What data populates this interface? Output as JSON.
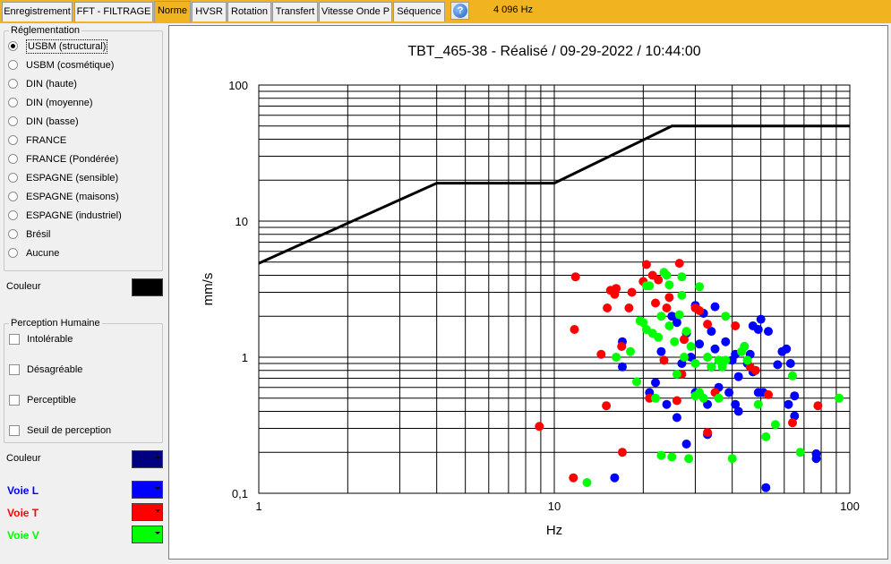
{
  "tabs": [
    {
      "label": "Enregistrement",
      "active": false
    },
    {
      "label": "FFT - FILTRAGE",
      "active": false
    },
    {
      "label": "Norme",
      "active": true
    },
    {
      "label": "HVSR",
      "active": false
    },
    {
      "label": "Rotation",
      "active": false
    },
    {
      "label": "Transfert",
      "active": false
    },
    {
      "label": "Vitesse Onde P",
      "active": false
    },
    {
      "label": "Séquence",
      "active": false
    }
  ],
  "help_icon": "help-icon",
  "sample_rate": "4 096 Hz",
  "reglementation": {
    "title": "Réglementation",
    "options": [
      {
        "label": "USBM (structural)",
        "checked": true
      },
      {
        "label": "USBM (cosmétique)",
        "checked": false
      },
      {
        "label": "DIN (haute)",
        "checked": false
      },
      {
        "label": "DIN (moyenne)",
        "checked": false
      },
      {
        "label": "DIN (basse)",
        "checked": false
      },
      {
        "label": "FRANCE",
        "checked": false
      },
      {
        "label": "FRANCE (Pondérée)",
        "checked": false
      },
      {
        "label": "ESPAGNE (sensible)",
        "checked": false
      },
      {
        "label": "ESPAGNE (maisons)",
        "checked": false
      },
      {
        "label": "ESPAGNE (industriel)",
        "checked": false
      },
      {
        "label": "Brésil",
        "checked": false
      },
      {
        "label": "Aucune",
        "checked": false
      }
    ]
  },
  "couleur_norme": {
    "label": "Couleur",
    "color": "#000000"
  },
  "perception": {
    "title": "Perception Humaine",
    "options": [
      {
        "label": "Intolérable",
        "checked": false
      },
      {
        "label": "Désagréable",
        "checked": false
      },
      {
        "label": "Perceptible",
        "checked": false
      },
      {
        "label": "Seuil de perception",
        "checked": false
      }
    ]
  },
  "couleur_perception": {
    "label": "Couleur",
    "color": "#000080"
  },
  "voies": [
    {
      "label": "Voie L",
      "color": "#0000ff"
    },
    {
      "label": "Voie T",
      "color": "#ff0000"
    },
    {
      "label": "Voie V",
      "color": "#00ff00"
    }
  ],
  "chart_data": {
    "type": "scatter",
    "title": "TBT_465-38 - Réalisé / 09-29-2022 / 10:44:00",
    "xlabel": "Hz",
    "ylabel": "mm/s",
    "x_scale": "log",
    "y_scale": "log",
    "xlim": [
      1,
      100
    ],
    "ylim": [
      0.1,
      100
    ],
    "x_tick_labels": [
      "1",
      "10",
      "100"
    ],
    "y_tick_labels": [
      "0,1",
      "1",
      "10",
      "100"
    ],
    "grid": true,
    "norm_color": "#000000",
    "norm_curve": [
      [
        1,
        4.9
      ],
      [
        4,
        19
      ],
      [
        10,
        19
      ],
      [
        25,
        50
      ],
      [
        100,
        50
      ]
    ],
    "series": [
      {
        "color": "#0000ff",
        "points": [
          [
            16,
            0.13
          ],
          [
            17,
            0.85
          ],
          [
            17,
            1.3
          ],
          [
            21,
            0.55
          ],
          [
            22,
            0.65
          ],
          [
            23,
            1.1
          ],
          [
            24,
            0.45
          ],
          [
            25,
            2.0
          ],
          [
            26,
            0.36
          ],
          [
            26,
            1.8
          ],
          [
            27,
            0.9
          ],
          [
            28,
            0.23
          ],
          [
            28,
            1.5
          ],
          [
            29,
            1.0
          ],
          [
            30,
            2.4
          ],
          [
            30,
            0.55
          ],
          [
            31,
            1.25
          ],
          [
            32,
            2.1
          ],
          [
            33,
            0.45
          ],
          [
            33,
            0.27
          ],
          [
            34,
            0.85
          ],
          [
            34,
            1.55
          ],
          [
            35,
            1.15
          ],
          [
            35,
            2.35
          ],
          [
            36,
            0.6
          ],
          [
            37,
            0.9
          ],
          [
            38,
            1.3
          ],
          [
            39,
            0.55
          ],
          [
            40,
            0.95
          ],
          [
            41,
            1.05
          ],
          [
            41,
            0.45
          ],
          [
            42,
            0.72
          ],
          [
            42,
            0.4
          ],
          [
            44,
            1.2
          ],
          [
            45,
            0.9
          ],
          [
            46,
            1.05
          ],
          [
            47,
            0.78
          ],
          [
            47,
            1.7
          ],
          [
            49,
            0.55
          ],
          [
            49,
            1.6
          ],
          [
            50,
            1.9
          ],
          [
            51,
            0.55
          ],
          [
            52,
            0.11
          ],
          [
            53,
            1.55
          ],
          [
            57,
            0.88
          ],
          [
            59,
            1.1
          ],
          [
            61,
            1.15
          ],
          [
            62,
            0.45
          ],
          [
            63,
            0.9
          ],
          [
            65,
            0.52
          ],
          [
            65,
            0.37
          ],
          [
            77,
            0.195
          ],
          [
            77,
            0.18
          ]
        ]
      },
      {
        "color": "#ff0000",
        "points": [
          [
            8.9,
            0.31
          ],
          [
            11.6,
            0.13
          ],
          [
            11.7,
            1.6
          ],
          [
            11.8,
            3.9
          ],
          [
            14.4,
            1.05
          ],
          [
            15,
            0.44
          ],
          [
            15.1,
            2.3
          ],
          [
            15.5,
            3.1
          ],
          [
            16,
            2.9
          ],
          [
            16.2,
            3.2
          ],
          [
            16.9,
            1.2
          ],
          [
            17,
            0.2
          ],
          [
            17.9,
            2.3
          ],
          [
            18.3,
            3.0
          ],
          [
            20,
            3.6
          ],
          [
            20.5,
            4.8
          ],
          [
            21,
            0.5
          ],
          [
            21.5,
            4.0
          ],
          [
            22,
            2.5
          ],
          [
            22.5,
            3.7
          ],
          [
            23.5,
            0.95
          ],
          [
            24,
            2.3
          ],
          [
            24.5,
            2.75
          ],
          [
            26,
            0.48
          ],
          [
            26.5,
            4.9
          ],
          [
            27,
            0.75
          ],
          [
            27.5,
            1.35
          ],
          [
            30,
            2.3
          ],
          [
            31,
            2.2
          ],
          [
            33,
            0.28
          ],
          [
            33,
            1.75
          ],
          [
            35,
            0.55
          ],
          [
            41,
            1.7
          ],
          [
            46,
            0.85
          ],
          [
            48,
            0.8
          ],
          [
            53,
            0.53
          ],
          [
            64,
            0.33
          ],
          [
            78,
            0.44
          ]
        ]
      },
      {
        "color": "#00ff00",
        "points": [
          [
            12.9,
            0.12
          ],
          [
            16.2,
            1.0
          ],
          [
            18.1,
            1.1
          ],
          [
            19,
            0.66
          ],
          [
            19.5,
            1.85
          ],
          [
            20,
            1.8
          ],
          [
            20.5,
            1.6
          ],
          [
            20.5,
            3.35
          ],
          [
            21,
            3.35
          ],
          [
            21.5,
            1.5
          ],
          [
            22,
            0.5
          ],
          [
            22.5,
            1.4
          ],
          [
            23,
            0.19
          ],
          [
            23,
            2.0
          ],
          [
            23.5,
            4.2
          ],
          [
            24,
            4.0
          ],
          [
            24.5,
            1.7
          ],
          [
            24.5,
            3.4
          ],
          [
            25,
            0.185
          ],
          [
            25.5,
            1.3
          ],
          [
            26,
            0.75
          ],
          [
            26.5,
            2.05
          ],
          [
            27,
            2.85
          ],
          [
            27,
            3.9
          ],
          [
            27.5,
            1.0
          ],
          [
            28,
            1.55
          ],
          [
            28.5,
            0.18
          ],
          [
            29,
            1.2
          ],
          [
            30,
            0.52
          ],
          [
            30,
            0.9
          ],
          [
            31,
            0.55
          ],
          [
            31,
            3.3
          ],
          [
            32,
            0.5
          ],
          [
            33,
            1.0
          ],
          [
            34,
            0.85
          ],
          [
            36,
            0.95
          ],
          [
            36,
            0.5
          ],
          [
            37,
            0.85
          ],
          [
            38,
            0.95
          ],
          [
            38,
            2.0
          ],
          [
            40,
            0.18
          ],
          [
            43,
            1.1
          ],
          [
            44,
            1.2
          ],
          [
            45,
            0.95
          ],
          [
            49,
            0.45
          ],
          [
            52,
            0.26
          ],
          [
            56,
            0.32
          ],
          [
            64,
            0.73
          ],
          [
            68,
            0.2
          ],
          [
            92,
            0.5
          ]
        ]
      }
    ]
  }
}
